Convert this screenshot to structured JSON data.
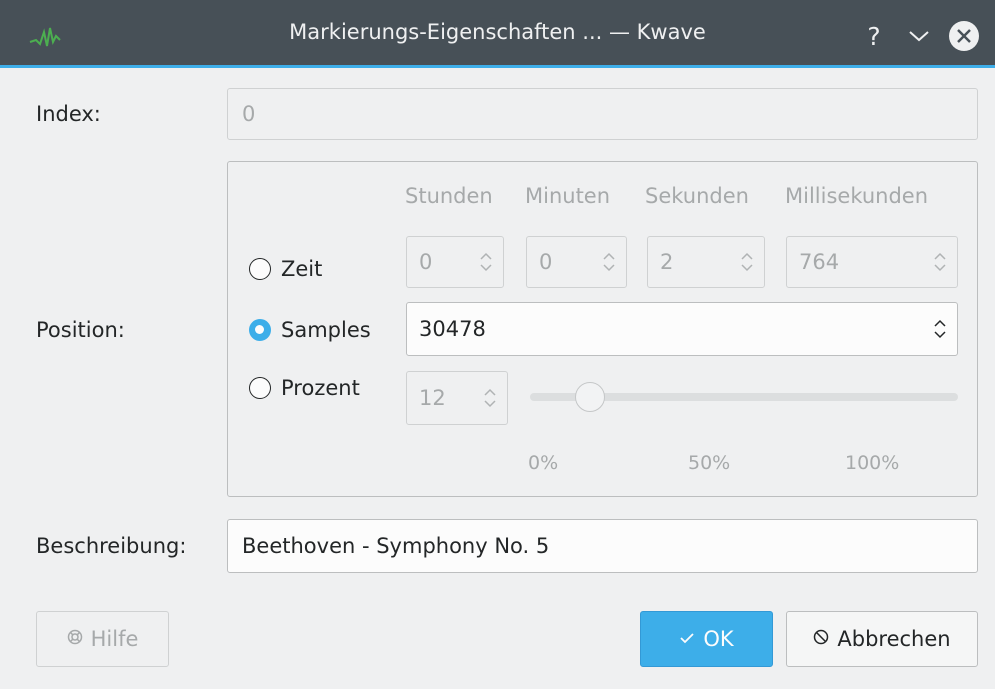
{
  "window": {
    "title": "Markierungs-Eigenschaften ... — Kwave",
    "help_glyph": "?",
    "accent": "#3daee9"
  },
  "index": {
    "label": "Index:",
    "value": "0"
  },
  "position": {
    "label": "Position:",
    "columns": [
      "Stunden",
      "Minuten",
      "Sekunden",
      "Millisekunden"
    ],
    "time": {
      "label": "Zeit",
      "values": [
        "0",
        "0",
        "2",
        "764"
      ],
      "selected": false
    },
    "samples": {
      "label": "Samples",
      "value": "30478",
      "selected": true
    },
    "percent": {
      "label": "Prozent",
      "value": "12",
      "slider_value_percent": 12,
      "selected": false
    },
    "ticks": [
      "0%",
      "50%",
      "100%"
    ]
  },
  "description": {
    "label": "Beschreibung:",
    "value": "Beethoven - Symphony No. 5"
  },
  "buttons": {
    "help": {
      "label": "Hilfe",
      "icon": "help-lifebuoy-icon"
    },
    "ok": {
      "label": "OK",
      "icon": "checkmark-icon"
    },
    "cancel": {
      "label": "Abbrechen",
      "icon": "cancel-circle-icon"
    }
  }
}
